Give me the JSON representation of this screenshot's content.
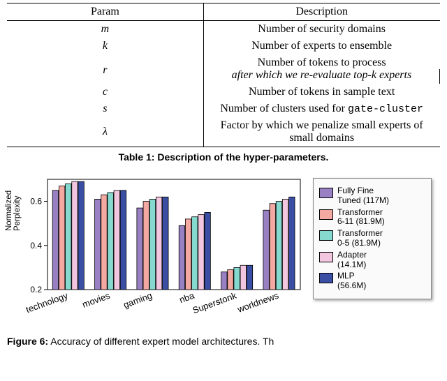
{
  "table": {
    "headers": {
      "param": "Param",
      "desc": "Description"
    },
    "rows": [
      {
        "param": "m",
        "desc": "Number of security domains"
      },
      {
        "param": "k",
        "desc": "Number of experts to ensemble"
      },
      {
        "param": "r",
        "desc_line1": "Number of tokens to process",
        "desc_line2_pre": "after which we re-evaluate top-",
        "desc_line2_k": "k",
        "desc_line2_post": " experts"
      },
      {
        "param": "c",
        "desc": "Number of tokens in sample text"
      },
      {
        "param": "s",
        "desc_pre": "Number of clusters used for ",
        "desc_code": "gate-cluster"
      },
      {
        "param": "λ",
        "desc": "Factor by which we penalize small experts of small domains"
      }
    ],
    "caption_bold": "Table 1:",
    "caption_rest": " Description of the hyper-parameters."
  },
  "chart_data": {
    "type": "bar",
    "categories": [
      "technology",
      "movies",
      "gaming",
      "nba",
      "Superstonk",
      "worldnews"
    ],
    "series": [
      {
        "name": "Fully Fine Tuned (117M)",
        "color": "#9880c2",
        "values": [
          0.65,
          0.61,
          0.57,
          0.49,
          0.28,
          0.56
        ]
      },
      {
        "name": "Transformer 6-11 (81.9M)",
        "color": "#f3a8a1",
        "values": [
          0.67,
          0.63,
          0.6,
          0.52,
          0.29,
          0.59
        ]
      },
      {
        "name": "Transformer 0-5 (81.9M)",
        "color": "#86d9cf",
        "values": [
          0.68,
          0.64,
          0.61,
          0.53,
          0.3,
          0.6
        ]
      },
      {
        "name": "Adapter (14.1M)",
        "color": "#f2c6de",
        "values": [
          0.69,
          0.65,
          0.62,
          0.54,
          0.31,
          0.61
        ]
      },
      {
        "name": "MLP (56.6M)",
        "color": "#3a4fa3",
        "values": [
          0.69,
          0.65,
          0.62,
          0.55,
          0.31,
          0.62
        ]
      }
    ],
    "ylabel_line1": "Normalized",
    "ylabel_line2": "Perplexity",
    "ylim": [
      0.2,
      0.7
    ],
    "yticks": [
      0.2,
      0.4,
      0.6
    ]
  },
  "legend_items": [
    {
      "color": "#9880c2",
      "line1": "Fully Fine",
      "line2": "Tuned (117M)"
    },
    {
      "color": "#f3a8a1",
      "line1": "Transformer",
      "line2": "6-11 (81.9M)"
    },
    {
      "color": "#86d9cf",
      "line1": "Transformer",
      "line2": "0-5 (81.9M)"
    },
    {
      "color": "#f2c6de",
      "line1": "Adapter",
      "line2": "(14.1M)"
    },
    {
      "color": "#3a4fa3",
      "line1": "MLP",
      "line2": "(56.6M)"
    }
  ],
  "figure_caption_fragment": "Figure 6: Accuracy of different expert model architectures. Th"
}
